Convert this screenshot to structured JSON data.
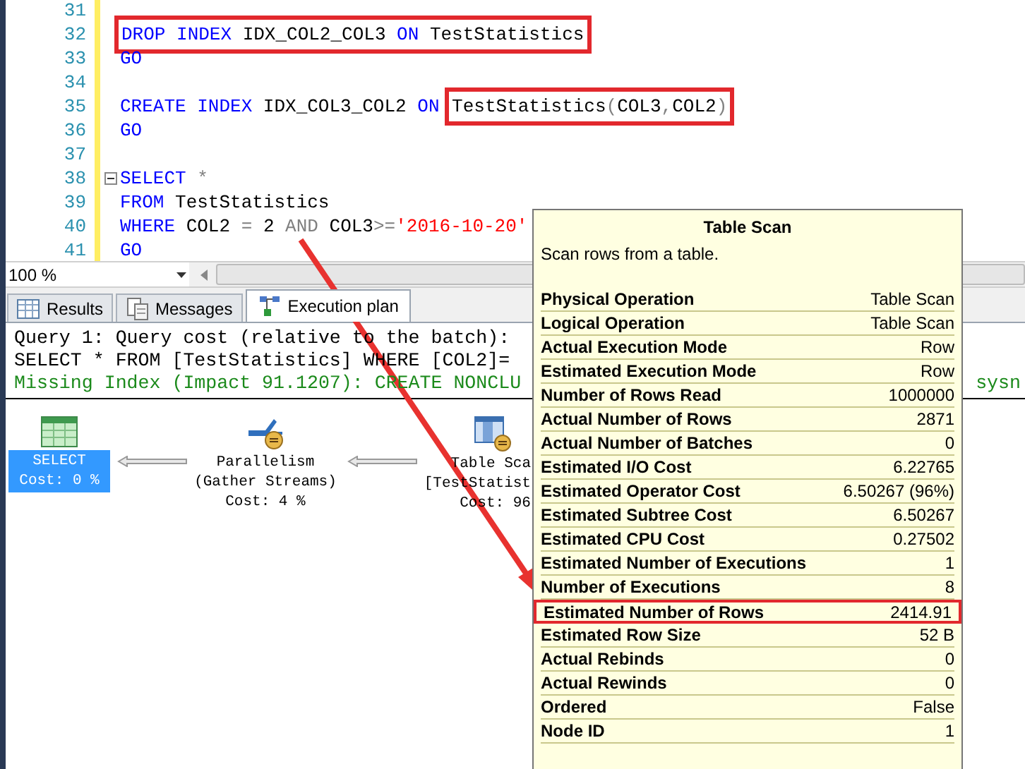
{
  "editor": {
    "lines": [
      {
        "number": "31",
        "fold": false
      },
      {
        "number": "32",
        "fold": false,
        "segments": [
          {
            "highlighted": true,
            "tokens": [
              {
                "text": "DROP ",
                "kind": "keyword"
              },
              {
                "text": "INDEX ",
                "kind": "keyword"
              },
              {
                "text": "IDX_COL2_COL3 ",
                "kind": "plain"
              },
              {
                "text": "ON ",
                "kind": "keyword"
              },
              {
                "text": "TestStatistics",
                "kind": "plain"
              }
            ]
          }
        ]
      },
      {
        "number": "33",
        "fold": false,
        "segments": [
          {
            "highlighted": false,
            "tokens": [
              {
                "text": "GO",
                "kind": "keyword"
              }
            ]
          }
        ]
      },
      {
        "number": "34",
        "fold": false
      },
      {
        "number": "35",
        "fold": false,
        "segments": [
          {
            "highlighted": false,
            "tokens": [
              {
                "text": "CREATE ",
                "kind": "keyword"
              },
              {
                "text": "INDEX ",
                "kind": "keyword"
              },
              {
                "text": "IDX_COL3_COL2 ",
                "kind": "plain"
              },
              {
                "text": "ON ",
                "kind": "keyword"
              }
            ]
          },
          {
            "highlighted": true,
            "tokens": [
              {
                "text": "TestStatistics",
                "kind": "plain"
              },
              {
                "text": "(",
                "kind": "operator"
              },
              {
                "text": "COL3",
                "kind": "plain"
              },
              {
                "text": ",",
                "kind": "operator"
              },
              {
                "text": "COL2",
                "kind": "plain"
              },
              {
                "text": ")",
                "kind": "operator"
              }
            ]
          }
        ]
      },
      {
        "number": "36",
        "fold": false,
        "segments": [
          {
            "highlighted": false,
            "tokens": [
              {
                "text": "GO",
                "kind": "keyword"
              }
            ]
          }
        ]
      },
      {
        "number": "37",
        "fold": false
      },
      {
        "number": "38",
        "fold": true,
        "segments": [
          {
            "highlighted": false,
            "tokens": [
              {
                "text": "SELECT ",
                "kind": "keyword"
              },
              {
                "text": "*",
                "kind": "operator"
              }
            ]
          }
        ]
      },
      {
        "number": "39",
        "fold": false,
        "segments": [
          {
            "highlighted": false,
            "tokens": [
              {
                "text": "FROM ",
                "kind": "keyword"
              },
              {
                "text": "TestStatistics",
                "kind": "plain"
              }
            ]
          }
        ]
      },
      {
        "number": "40",
        "fold": false,
        "segments": [
          {
            "highlighted": false,
            "tokens": [
              {
                "text": "WHERE ",
                "kind": "keyword"
              },
              {
                "text": "COL2 ",
                "kind": "plain"
              },
              {
                "text": "= ",
                "kind": "operator"
              },
              {
                "text": "2 ",
                "kind": "plain"
              },
              {
                "text": "AND ",
                "kind": "operator"
              },
              {
                "text": "COL3",
                "kind": "plain"
              },
              {
                "text": ">=",
                "kind": "operator"
              },
              {
                "text": "'2016-10-20'",
                "kind": "string"
              }
            ]
          }
        ]
      },
      {
        "number": "41",
        "fold": false,
        "segments": [
          {
            "highlighted": false,
            "tokens": [
              {
                "text": "GO",
                "kind": "keyword"
              }
            ]
          }
        ]
      }
    ]
  },
  "zoom": "100 %",
  "tabs": [
    {
      "label": "Results",
      "selected": false
    },
    {
      "label": "Messages",
      "selected": false
    },
    {
      "label": "Execution plan",
      "selected": true
    }
  ],
  "plan": {
    "header": [
      {
        "text": "Query 1: Query cost (relative to the batch):",
        "kind": "plain"
      },
      {
        "text": "SELECT * FROM [TestStatistics] WHERE [COL2]=",
        "kind": "plain"
      },
      {
        "text": "Missing Index (Impact 91.1207): CREATE NONCLU",
        "kind": "hint",
        "right": "sysn"
      }
    ],
    "nodes": [
      {
        "lines": [
          "SELECT",
          "Cost: 0 %"
        ],
        "selected": true
      },
      {
        "lines": [
          "Parallelism",
          "(Gather Streams)",
          "Cost: 4 %"
        ],
        "selected": false
      },
      {
        "lines": [
          "Table Sca",
          "[TestStatist",
          "Cost: 96"
        ],
        "selected": false
      }
    ]
  },
  "tooltip": {
    "title": "Table Scan",
    "description": "Scan rows from a table.",
    "rows": [
      {
        "label": "Physical Operation",
        "value": "Table Scan",
        "highlighted": false
      },
      {
        "label": "Logical Operation",
        "value": "Table Scan",
        "highlighted": false
      },
      {
        "label": "Actual Execution Mode",
        "value": "Row",
        "highlighted": false
      },
      {
        "label": "Estimated Execution Mode",
        "value": "Row",
        "highlighted": false
      },
      {
        "label": "Number of Rows Read",
        "value": "1000000",
        "highlighted": false
      },
      {
        "label": "Actual Number of Rows",
        "value": "2871",
        "highlighted": false
      },
      {
        "label": "Actual Number of Batches",
        "value": "0",
        "highlighted": false
      },
      {
        "label": "Estimated I/O Cost",
        "value": "6.22765",
        "highlighted": false
      },
      {
        "label": "Estimated Operator Cost",
        "value": "6.50267 (96%)",
        "highlighted": false
      },
      {
        "label": "Estimated Subtree Cost",
        "value": "6.50267",
        "highlighted": false
      },
      {
        "label": "Estimated CPU Cost",
        "value": "0.27502",
        "highlighted": false
      },
      {
        "label": "Estimated Number of Executions",
        "value": "1",
        "highlighted": false
      },
      {
        "label": "Number of Executions",
        "value": "8",
        "highlighted": false
      },
      {
        "label": "Estimated Number of Rows",
        "value": "2414.91",
        "highlighted": true
      },
      {
        "label": "Estimated Row Size",
        "value": "52 B",
        "highlighted": false
      },
      {
        "label": "Actual Rebinds",
        "value": "0",
        "highlighted": false
      },
      {
        "label": "Actual Rewinds",
        "value": "0",
        "highlighted": false
      },
      {
        "label": "Ordered",
        "value": "False",
        "highlighted": false
      },
      {
        "label": "Node ID",
        "value": "1",
        "highlighted": false
      }
    ]
  }
}
